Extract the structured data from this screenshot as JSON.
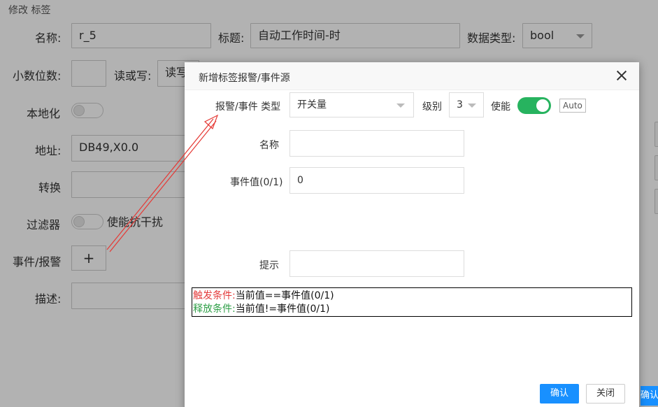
{
  "page": {
    "title": "修改 标签"
  },
  "form": {
    "name_label": "名称:",
    "name_value": "r_5",
    "caption_label": "标题:",
    "caption_value": "自动工作时间-时",
    "datatype_label": "数据类型:",
    "datatype_value": "bool",
    "decimals_label": "小数位数:",
    "decimals_value": "",
    "rw_label": "读或写:",
    "rw_value": "读写",
    "localize_label": "本地化",
    "address_label": "地址:",
    "address_value": "DB49,X0.0",
    "convert_label": "转换",
    "filter_label": "过滤器",
    "filter_text": "使能抗干扰",
    "event_label": "事件/报警",
    "event_add": "+",
    "desc_label": "描述:"
  },
  "modal": {
    "title": "新增标签报警/事件源",
    "type_label": "报警/事件 类型",
    "type_value": "开关量",
    "level_label": "级别",
    "level_value": "3",
    "enable_label": "使能",
    "enable_on": true,
    "auto_tag": "Auto",
    "name_label": "名称",
    "name_value": "",
    "event_value_label": "事件值(0/1)",
    "event_value": "0",
    "hint_label": "提示",
    "hint_value": "",
    "trigger_label": "触发条件:",
    "trigger_text": "当前值==事件值(0/1)",
    "release_label": "释放条件:",
    "release_text": "当前值!=事件值(0/1)",
    "ok_label": "确认",
    "close_label": "关闭"
  },
  "edge": {
    "ok_label": "确认"
  },
  "colors": {
    "primary": "#1890ff",
    "switch_on": "#27b35f",
    "trigger": "#e33b3b",
    "release": "#2e9f47",
    "annotation_arrow": "#e53935"
  }
}
